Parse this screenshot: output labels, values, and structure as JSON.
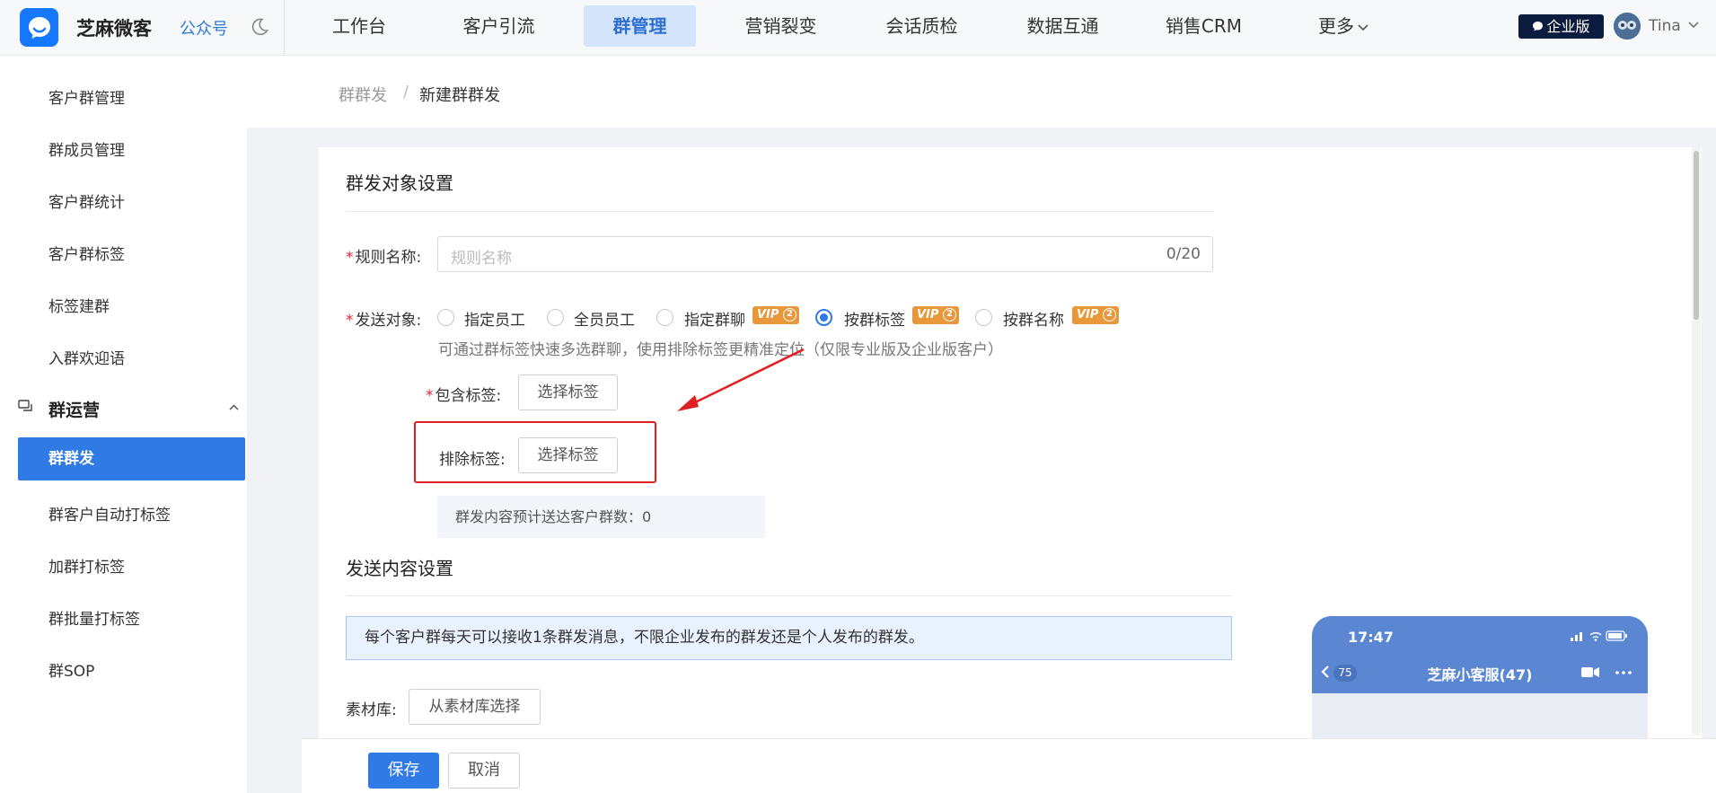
{
  "header": {
    "brand": "芝麻微客",
    "gzh": "公众号",
    "nav": [
      "工作台",
      "客户引流",
      "群管理",
      "营销裂变",
      "会话质检",
      "数据互通",
      "销售CRM",
      "更多"
    ],
    "active_nav": "群管理",
    "enterprise_badge": "企业版",
    "user_name": "Tina",
    "colors": {
      "accent": "#2f7ae5",
      "active_nav_bg": "#d4e5fb",
      "badge_bg": "#0b1c3e"
    }
  },
  "sidebar": {
    "items_top": [
      "客户群管理",
      "群成员管理",
      "客户群统计",
      "客户群标签",
      "标签建群",
      "入群欢迎语"
    ],
    "group_title": "群运营",
    "active_item": "群群发",
    "items_bottom": [
      "群客户自动打标签",
      "加群打标签",
      "群批量打标签",
      "群SOP"
    ]
  },
  "breadcrumb": {
    "parent": "群群发",
    "sep": "/",
    "current": "新建群群发"
  },
  "form": {
    "section1_title": "群发对象设置",
    "rule_label": "规则名称:",
    "rule_placeholder": "规则名称",
    "rule_counter": "0/20",
    "target_label": "发送对象:",
    "targets": [
      {
        "label": "指定员工",
        "vip": false,
        "checked": false
      },
      {
        "label": "全员员工",
        "vip": false,
        "checked": false
      },
      {
        "label": "指定群聊",
        "vip": true,
        "checked": false
      },
      {
        "label": "按群标签",
        "vip": true,
        "checked": true
      },
      {
        "label": "按群名称",
        "vip": true,
        "checked": false
      }
    ],
    "vip_text": "VIP",
    "vip_level": "2",
    "hint": "可通过群标签快速多选群聊，使用排除标签更精准定位（仅限专业版及企业版客户）",
    "include_label": "包含标签:",
    "exclude_label": "排除标签:",
    "choose_tag": "选择标签",
    "estimate": "群发内容预计送达客户群数：0",
    "section2_title": "发送内容设置",
    "notice": "每个客户群每天可以接收1条群发消息，不限企业发布的群发还是个人发布的群发。",
    "material_label": "素材库:",
    "material_btn": "从素材库选择"
  },
  "phone": {
    "time": "17:47",
    "back_count": "75",
    "title": "芝麻小客服(47)"
  },
  "footer": {
    "save": "保存",
    "cancel": "取消"
  }
}
